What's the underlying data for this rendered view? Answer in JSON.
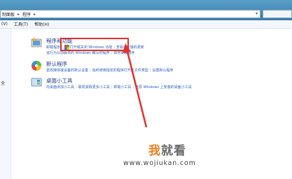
{
  "address": {
    "crumbs": [
      "制面板",
      "程序"
    ],
    "separator": "▸",
    "dropdown_glyph": "▾"
  },
  "menu": [
    "(V)",
    "工具(T)",
    "帮助(H)"
  ],
  "left_pane": {
    "partial_item": "全"
  },
  "sections": [
    {
      "title": "程序和功能",
      "icon": "programs-icon",
      "rows": [
        [
          "卸载程序",
          "打开或关闭 Windows 功能",
          "查看已安装的更新"
        ],
        [
          "运行为以前版本的 Windows 编写的程序",
          "如何安装程序"
        ]
      ]
    },
    {
      "title": "默认程序",
      "icon": "default-programs-icon",
      "rows": [
        [
          "更改媒体或设备的默认设置",
          "始终使用指定的程序打开此文件类型",
          "设置默认程序"
        ]
      ]
    },
    {
      "title": "桌面小工具",
      "icon": "gadgets-icon",
      "rows": [
        [
          "向桌面添加小工具",
          "联机获取更多小工具",
          "卸载小工具",
          "还原 Windows 上安装的桌面小工具"
        ]
      ]
    }
  ],
  "watermark": {
    "chars": [
      "我",
      "就",
      "看"
    ],
    "url": "www.wojiukan.com"
  },
  "colors": {
    "accent_red": "#e0302a",
    "link": "#2a5fb5",
    "title": "#1b3a8a"
  }
}
